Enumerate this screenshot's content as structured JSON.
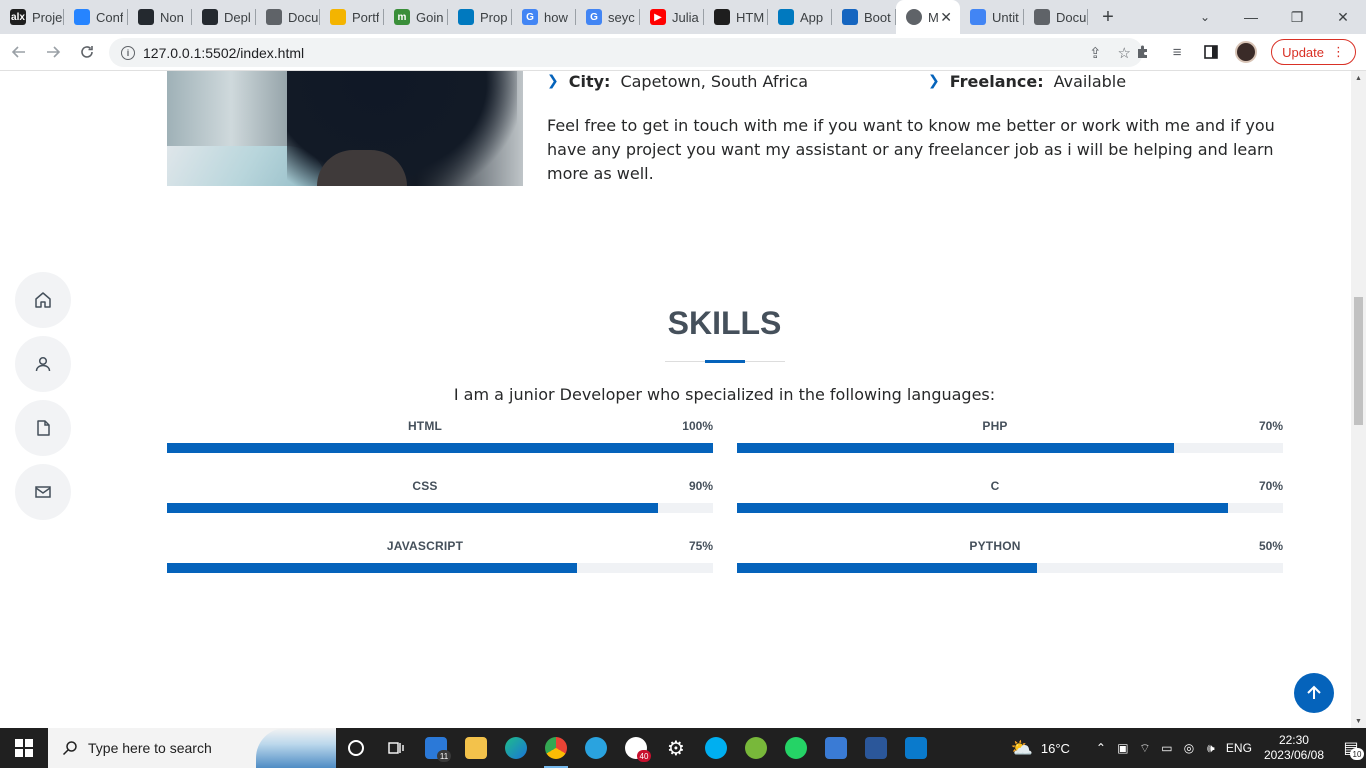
{
  "browser": {
    "tabs": [
      {
        "label": "Proje",
        "fav_color": "#1e1e1e",
        "fav_text": "alx"
      },
      {
        "label": "Conf",
        "fav_color": "#2684ff",
        "fav_text": ""
      },
      {
        "label": "Non",
        "fav_color": "#24292f",
        "fav_text": ""
      },
      {
        "label": "Depl",
        "fav_color": "#24292f",
        "fav_text": ""
      },
      {
        "label": "Docu",
        "fav_color": "#5f6368",
        "fav_text": ""
      },
      {
        "label": "Portf",
        "fav_color": "#f4b400",
        "fav_text": ""
      },
      {
        "label": "Goin",
        "fav_color": "#3a8f3a",
        "fav_text": "m"
      },
      {
        "label": "Prop",
        "fav_color": "#0079bf",
        "fav_text": ""
      },
      {
        "label": "how",
        "fav_color": "#4285f4",
        "fav_text": "G"
      },
      {
        "label": "seyc",
        "fav_color": "#4285f4",
        "fav_text": "G"
      },
      {
        "label": "Julia",
        "fav_color": "#ff0000",
        "fav_text": "▶"
      },
      {
        "label": "HTM",
        "fav_color": "#1e1e1e",
        "fav_text": ""
      },
      {
        "label": "App",
        "fav_color": "#0079bf",
        "fav_text": ""
      },
      {
        "label": "Boot",
        "fav_color": "#1565c0",
        "fav_text": ""
      }
    ],
    "active_tab": {
      "label": "M"
    },
    "tabs_after": [
      {
        "label": "Untit",
        "fav_color": "#4285f4",
        "fav_text": ""
      },
      {
        "label": "Docu",
        "fav_color": "#5f6368",
        "fav_text": ""
      }
    ],
    "url": "127.0.0.1:5502/index.html",
    "update_label": "Update"
  },
  "about": {
    "city_label": "City:",
    "city_value": "Capetown, South Africa",
    "freelance_label": "Freelance:",
    "freelance_value": "Available",
    "paragraph": "Feel free to get in touch with me if you want to know me better or work with me and if you have any project you want my assistant or any freelancer job as i will be helping and learn more as well."
  },
  "skills": {
    "title": "SKILLS",
    "description": "I am a junior Developer who specialized in the following languages:",
    "items": [
      {
        "name": "HTML",
        "label": "100%",
        "value": 100
      },
      {
        "name": "PHP",
        "label": "70%",
        "value": 80
      },
      {
        "name": "CSS",
        "label": "90%",
        "value": 90
      },
      {
        "name": "C",
        "label": "70%",
        "value": 90
      },
      {
        "name": "JAVASCRIPT",
        "label": "75%",
        "value": 75
      },
      {
        "name": "PYTHON",
        "label": "50%",
        "value": 55
      }
    ],
    "accent_color": "#0563bb"
  },
  "side_nav": [
    "home-icon",
    "person-icon",
    "file-icon",
    "envelope-icon"
  ],
  "taskbar": {
    "search_placeholder": "Type here to search",
    "weather": "16°C",
    "language": "ENG",
    "time": "22:30",
    "date": "2023/06/08",
    "mail_badge": "11",
    "slack_badge": "40",
    "notif_badge": "10"
  }
}
